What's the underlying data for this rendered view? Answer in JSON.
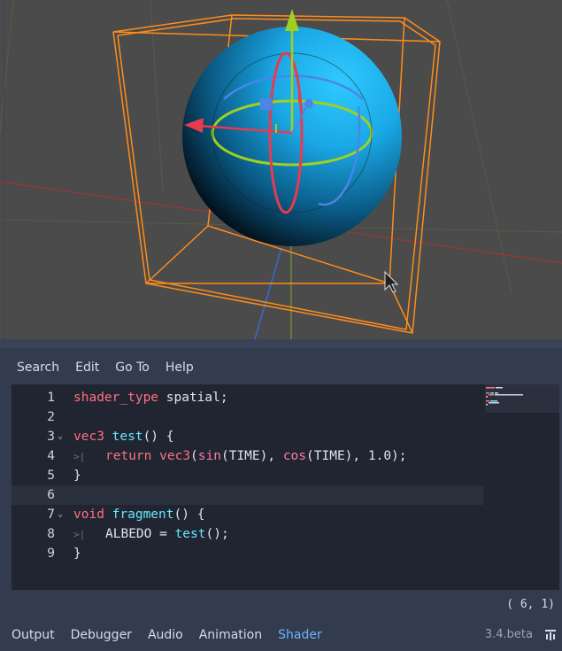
{
  "menu": {
    "items": [
      "Search",
      "Edit",
      "Go To",
      "Help"
    ]
  },
  "code": {
    "current_line": 6,
    "lines": [
      {
        "n": "1",
        "fold": false,
        "tab": false,
        "tokens": [
          [
            "kw",
            "shader_type"
          ],
          [
            "id",
            " spatial;"
          ]
        ]
      },
      {
        "n": "2",
        "fold": false,
        "tab": false,
        "tokens": []
      },
      {
        "n": "3",
        "fold": true,
        "tab": false,
        "tokens": [
          [
            "kw",
            "vec3"
          ],
          [
            "id",
            " "
          ],
          [
            "fn",
            "test"
          ],
          [
            "id",
            "() {"
          ]
        ]
      },
      {
        "n": "4",
        "fold": false,
        "tab": true,
        "tokens": [
          [
            "kw",
            "return"
          ],
          [
            "id",
            " "
          ],
          [
            "kw",
            "vec3"
          ],
          [
            "id",
            "("
          ],
          [
            "bi",
            "sin"
          ],
          [
            "id",
            "(TIME), "
          ],
          [
            "bi",
            "cos"
          ],
          [
            "id",
            "(TIME), 1.0);"
          ]
        ]
      },
      {
        "n": "5",
        "fold": false,
        "tab": false,
        "tokens": [
          [
            "id",
            "}"
          ]
        ]
      },
      {
        "n": "6",
        "fold": false,
        "tab": false,
        "tokens": []
      },
      {
        "n": "7",
        "fold": true,
        "tab": false,
        "tokens": [
          [
            "kw",
            "void"
          ],
          [
            "id",
            " "
          ],
          [
            "fn",
            "fragment"
          ],
          [
            "id",
            "() {"
          ]
        ]
      },
      {
        "n": "8",
        "fold": false,
        "tab": true,
        "tokens": [
          [
            "id",
            "ALBEDO = "
          ],
          [
            "fn",
            "test"
          ],
          [
            "id",
            "();"
          ]
        ]
      },
      {
        "n": "9",
        "fold": false,
        "tab": false,
        "tokens": [
          [
            "id",
            "}"
          ]
        ]
      }
    ]
  },
  "status": {
    "cursor_position": "(   6,   1)"
  },
  "bottom_panel": {
    "tabs": [
      "Output",
      "Debugger",
      "Audio",
      "Animation",
      "Shader"
    ],
    "active_tab": "Shader",
    "version": "3.4.beta"
  },
  "colors": {
    "keyword": "#ff7085",
    "function": "#66e6ff",
    "active_tab": "#6fb3ff",
    "selection_box": "#ff8c1a",
    "sphere": "#1ec0f5"
  },
  "icons": {
    "pin": "pin-icon",
    "fold": "chevron-down-icon",
    "tab": "tab-indicator-icon"
  }
}
